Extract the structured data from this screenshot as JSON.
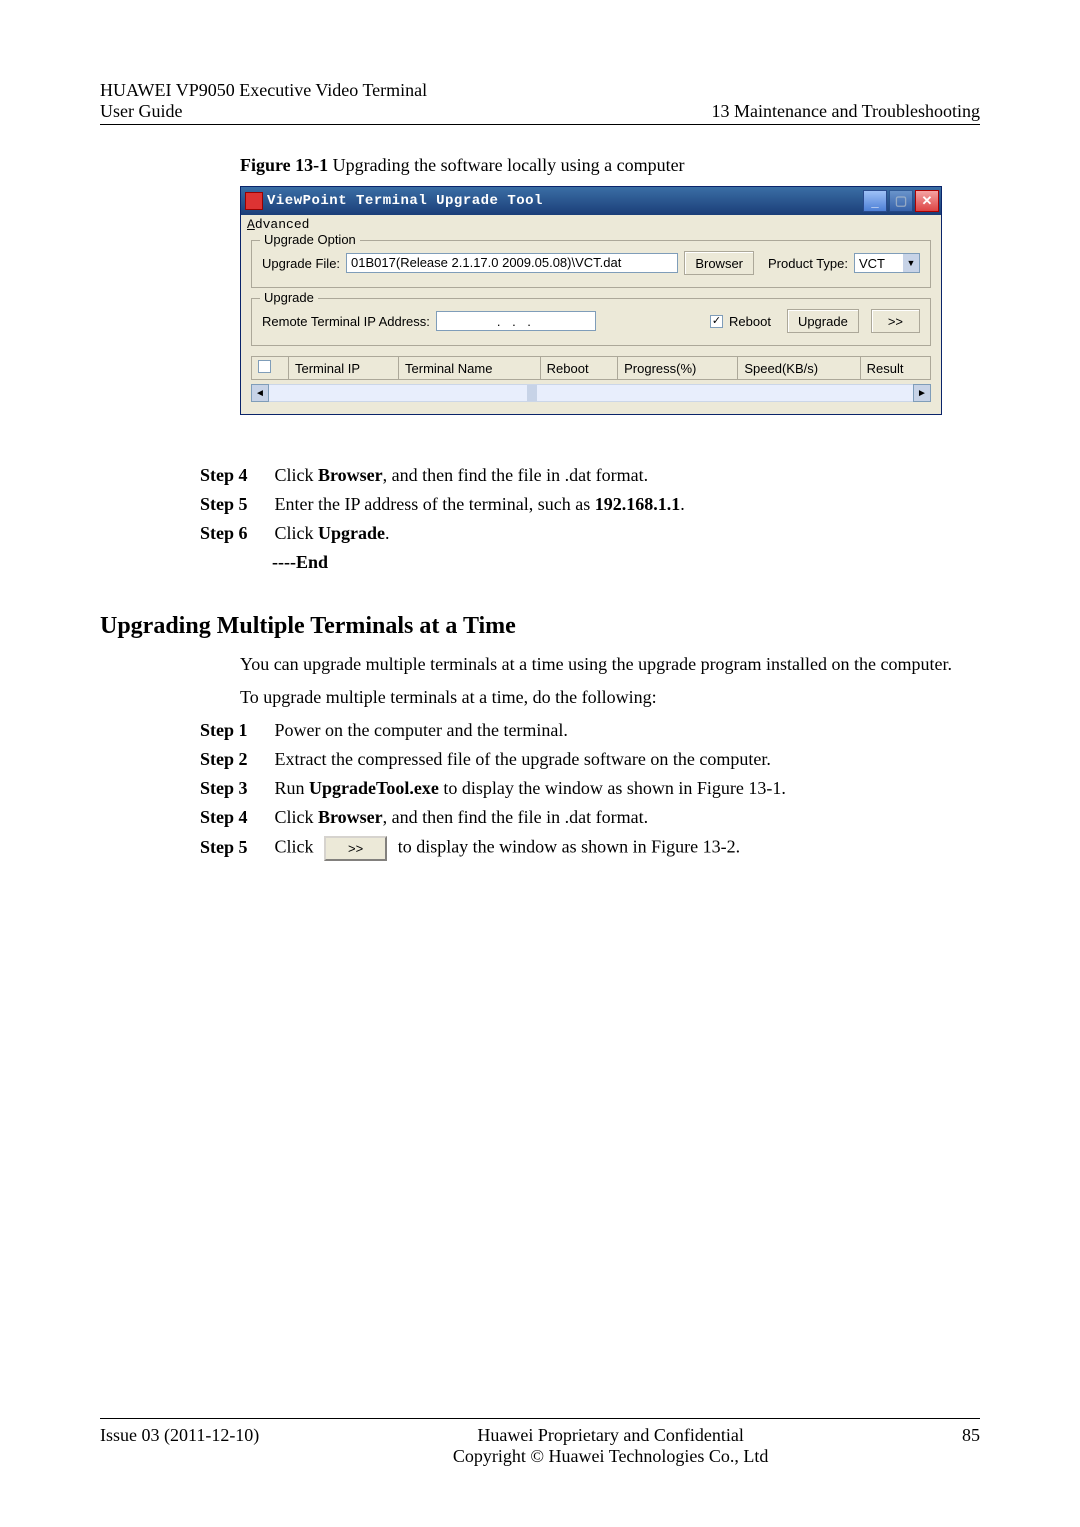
{
  "header": {
    "product": "HUAWEI VP9050 Executive Video Terminal",
    "doc_type": "User Guide",
    "chapter": "13 Maintenance and Troubleshooting"
  },
  "figure": {
    "label": "Figure 13-1",
    "caption": " Upgrading the software locally using a computer"
  },
  "app": {
    "title": "ViewPoint Terminal Upgrade Tool",
    "menu": {
      "advanced_first": "A",
      "advanced_rest": "dvanced"
    },
    "group_option": {
      "legend": "Upgrade Option",
      "file_label": "Upgrade File:",
      "file_value": "01B017(Release 2.1.17.0 2009.05.08)\\VCT.dat",
      "browser_btn": "Browser",
      "ptype_label": "Product Type:",
      "ptype_value": "VCT"
    },
    "group_upgrade": {
      "legend": "Upgrade",
      "ip_label": "Remote Terminal IP Address:",
      "ip_value": ".       .       .",
      "reboot_label": "Reboot",
      "reboot_checked": "✓",
      "upgrade_btn": "Upgrade",
      "expand_btn": ">>"
    },
    "table": {
      "col1": "Terminal IP",
      "col2": "Terminal Name",
      "col3": "Reboot",
      "col4": "Progress(%)",
      "col5": "Speed(KB/s)",
      "col6": "Result"
    }
  },
  "steps_a": {
    "s4_label": "Step 4",
    "s4_a": "Click ",
    "s4_b": "Browser",
    "s4_c": ", and then find the file in .dat format.",
    "s5_label": "Step 5",
    "s5_a": "Enter the IP address of the terminal, such as ",
    "s5_b": "192.168.1.1",
    "s5_c": ".",
    "s6_label": "Step 6",
    "s6_a": "Click ",
    "s6_b": "Upgrade",
    "s6_c": ".",
    "end": "----End"
  },
  "section2": {
    "title": "Upgrading Multiple Terminals at a Time",
    "p1": "You can upgrade multiple terminals at a time using the upgrade program installed on the computer.",
    "p2": "To upgrade multiple terminals at a time, do the following:"
  },
  "steps_b": {
    "s1_label": "Step 1",
    "s1_text": "Power on the computer and the terminal.",
    "s2_label": "Step 2",
    "s2_text": "Extract the compressed file of the upgrade software on the computer.",
    "s3_label": "Step 3",
    "s3_a": "Run ",
    "s3_b": "UpgradeTool.exe",
    "s3_c": " to display the window as shown in Figure 13-1.",
    "s4_label": "Step 4",
    "s4_a": "Click ",
    "s4_b": "Browser",
    "s4_c": ", and then find the file in .dat format.",
    "s5_label": "Step 5",
    "s5_a": "Click ",
    "s5_btn": ">>",
    "s5_b": " to display the window as shown in Figure 13-2."
  },
  "footer": {
    "issue": "Issue 03 (2011-12-10)",
    "line1": "Huawei Proprietary and Confidential",
    "line2": "Copyright © Huawei Technologies Co., Ltd",
    "page": "85"
  }
}
